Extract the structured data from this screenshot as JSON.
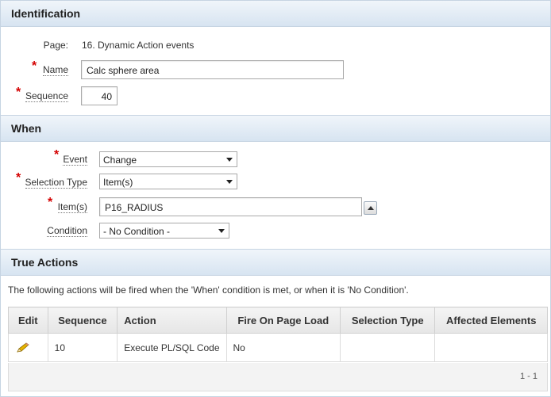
{
  "identification": {
    "header": "Identification",
    "page_label": "Page:",
    "page_value": "16. Dynamic Action events",
    "name_label": "Name",
    "name_value": "Calc sphere area",
    "sequence_label": "Sequence",
    "sequence_value": "40"
  },
  "when": {
    "header": "When",
    "event_label": "Event",
    "event_value": "Change",
    "selection_type_label": "Selection Type",
    "selection_type_value": "Item(s)",
    "items_label": "Item(s)",
    "items_value": "P16_RADIUS",
    "condition_label": "Condition",
    "condition_value": "- No Condition -"
  },
  "true_actions": {
    "header": "True Actions",
    "description": "The following actions will be fired when the 'When' condition is met, or when it is 'No Condition'.",
    "columns": [
      "Edit",
      "Sequence",
      "Action",
      "Fire On Page Load",
      "Selection Type",
      "Affected Elements"
    ],
    "rows": [
      {
        "sequence": "10",
        "action": "Execute PL/SQL Code",
        "fire_on_page_load": "No",
        "selection_type": "",
        "affected_elements": ""
      }
    ],
    "pagination": "1 - 1"
  },
  "icons": {
    "edit": "pencil-icon",
    "required": "asterisk",
    "popup": "chevron-up-icon"
  },
  "colors": {
    "required": "#d40000",
    "header_bg": "#d7e4f1",
    "border": "#c6d4e2"
  }
}
